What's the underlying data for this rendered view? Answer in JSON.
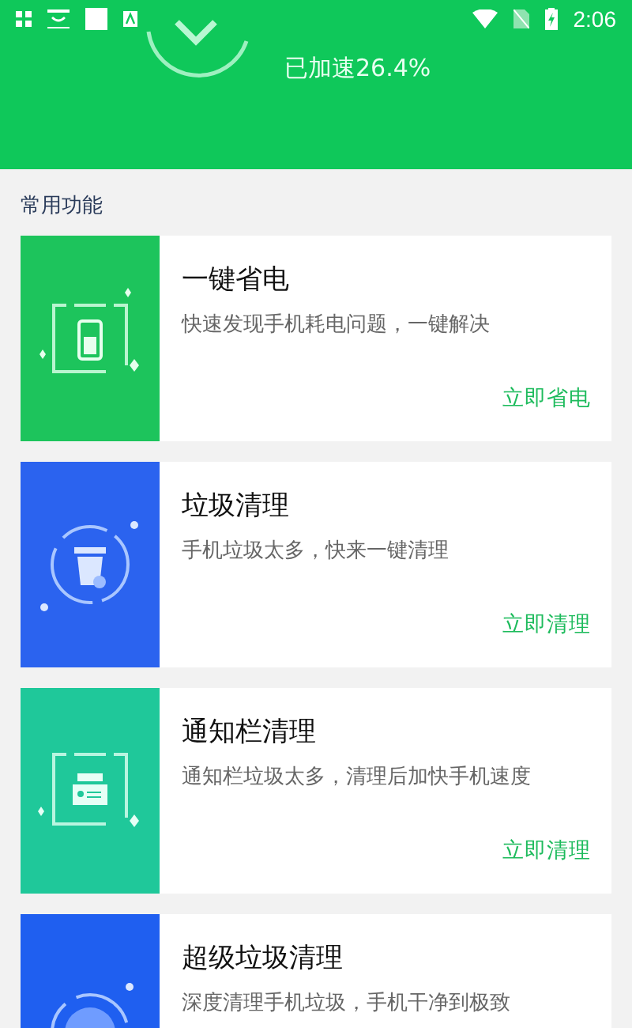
{
  "status_bar": {
    "time": "2:06"
  },
  "header": {
    "result": "已加速26.4%"
  },
  "section_title": "常用功能",
  "cards": [
    {
      "kind": "battery",
      "color": "#1dc45c",
      "title": "一键省电",
      "desc": "快速发现手机耗电问题，一键解决",
      "action": "立即省电"
    },
    {
      "kind": "trash",
      "color": "#2b63ef",
      "title": "垃圾清理",
      "desc": "手机垃圾太多，快来一键清理",
      "action": "立即清理"
    },
    {
      "kind": "notify",
      "color": "#1fc89a",
      "title": "通知栏清理",
      "desc": "通知栏垃圾太多，清理后加快手机速度",
      "action": "立即清理"
    },
    {
      "kind": "disk",
      "color": "#1f5ff0",
      "title": "超级垃圾清理",
      "desc": "深度清理手机垃圾，手机干净到极致"
    }
  ]
}
